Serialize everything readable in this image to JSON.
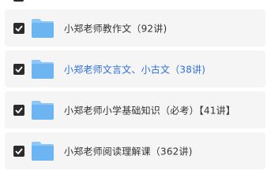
{
  "colors": {
    "row_background": "#f5f5f5",
    "checkbox_fill": "#2b2b2b",
    "folder_blue": "#6cb4f2",
    "folder_tab": "#8ec6f5",
    "text_default": "#333333",
    "text_active": "#2f6fd6"
  },
  "folders": [
    {
      "label": "小郑老师教作文（92讲)",
      "checked": true,
      "active": false,
      "icon": "folder-icon"
    },
    {
      "label": "小郑老师文言文、小古文（38讲)",
      "checked": true,
      "active": true,
      "icon": "folder-icon"
    },
    {
      "label": "小郑老师小学基础知识（必考）【41讲】",
      "checked": true,
      "active": false,
      "icon": "folder-icon"
    },
    {
      "label": "小郑老师阅读理解课（362讲)",
      "checked": true,
      "active": false,
      "icon": "folder-icon"
    }
  ]
}
